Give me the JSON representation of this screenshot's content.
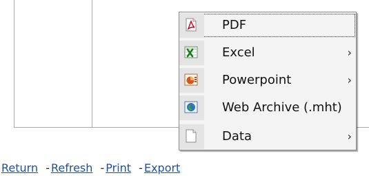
{
  "export_menu": {
    "items": [
      {
        "label": "PDF",
        "icon": "pdf-icon",
        "has_submenu": false,
        "focused": true
      },
      {
        "label": "Excel",
        "icon": "excel-icon",
        "has_submenu": true
      },
      {
        "label": "Powerpoint",
        "icon": "powerpoint-icon",
        "has_submenu": true
      },
      {
        "label": "Web Archive (.mht)",
        "icon": "web-archive-icon",
        "has_submenu": false
      },
      {
        "label": "Data",
        "icon": "data-icon",
        "has_submenu": true
      }
    ],
    "submenu_arrow": "›"
  },
  "footer_links": {
    "return_label": "Return",
    "refresh_label": "Refresh",
    "print_label": "Print",
    "export_label": "Export",
    "separator": "-"
  },
  "colors": {
    "link": "#1f4fa3",
    "menu_background": "#f4f4f4",
    "grid_line": "#a8a8a8"
  }
}
